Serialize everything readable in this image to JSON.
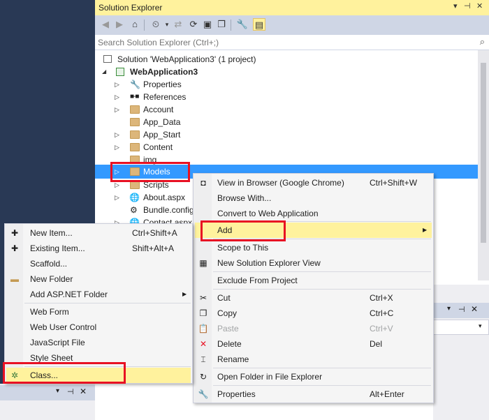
{
  "solution_explorer": {
    "title": "Solution Explorer",
    "pin_icon": "pin-icon",
    "close_icon": "close-icon",
    "search_placeholder": "Search Solution Explorer (Ctrl+;)",
    "toolbar_icons": [
      "back-icon",
      "forward-icon",
      "home-icon",
      "history-icon",
      "sync-icon",
      "refresh-icon",
      "collapse-icon",
      "copy-icon",
      "properties-icon",
      "preview-icon"
    ],
    "tree": {
      "solution": "Solution 'WebApplication3' (1 project)",
      "project": "WebApplication3",
      "items": [
        "Properties",
        "References",
        "Account",
        "App_Data",
        "App_Start",
        "Content",
        "img",
        "Models",
        "Scripts",
        "About.aspx",
        "Bundle.config",
        "Contact.aspx"
      ]
    }
  },
  "context_menu": {
    "items": [
      {
        "label": "View in Browser (Google Chrome)",
        "shortcut": "Ctrl+Shift+W"
      },
      {
        "label": "Browse With...",
        "shortcut": ""
      },
      {
        "label": "Convert to Web Application",
        "shortcut": ""
      },
      {
        "label": "Add",
        "shortcut": ""
      },
      {
        "label": "Scope to This",
        "shortcut": ""
      },
      {
        "label": "New Solution Explorer View",
        "shortcut": ""
      },
      {
        "label": "Exclude From Project",
        "shortcut": ""
      },
      {
        "label": "Cut",
        "shortcut": "Ctrl+X"
      },
      {
        "label": "Copy",
        "shortcut": "Ctrl+C"
      },
      {
        "label": "Paste",
        "shortcut": "Ctrl+V"
      },
      {
        "label": "Delete",
        "shortcut": "Del"
      },
      {
        "label": "Rename",
        "shortcut": ""
      },
      {
        "label": "Open Folder in File Explorer",
        "shortcut": ""
      },
      {
        "label": "Properties",
        "shortcut": "Alt+Enter"
      }
    ]
  },
  "add_submenu": {
    "items": [
      {
        "label": "New Item...",
        "shortcut": "Ctrl+Shift+A"
      },
      {
        "label": "Existing Item...",
        "shortcut": "Shift+Alt+A"
      },
      {
        "label": "Scaffold...",
        "shortcut": ""
      },
      {
        "label": "New Folder",
        "shortcut": ""
      },
      {
        "label": "Add ASP.NET Folder",
        "shortcut": ""
      },
      {
        "label": "Web Form",
        "shortcut": ""
      },
      {
        "label": "Web User Control",
        "shortcut": ""
      },
      {
        "label": "JavaScript File",
        "shortcut": ""
      },
      {
        "label": "Style Sheet",
        "shortcut": ""
      },
      {
        "label": "Class...",
        "shortcut": ""
      }
    ]
  },
  "colors": {
    "highlight": "#fff29d",
    "selection": "#3399ff",
    "callout": "#e81123",
    "toolbar": "#cfd6e5",
    "background": "#293955"
  }
}
